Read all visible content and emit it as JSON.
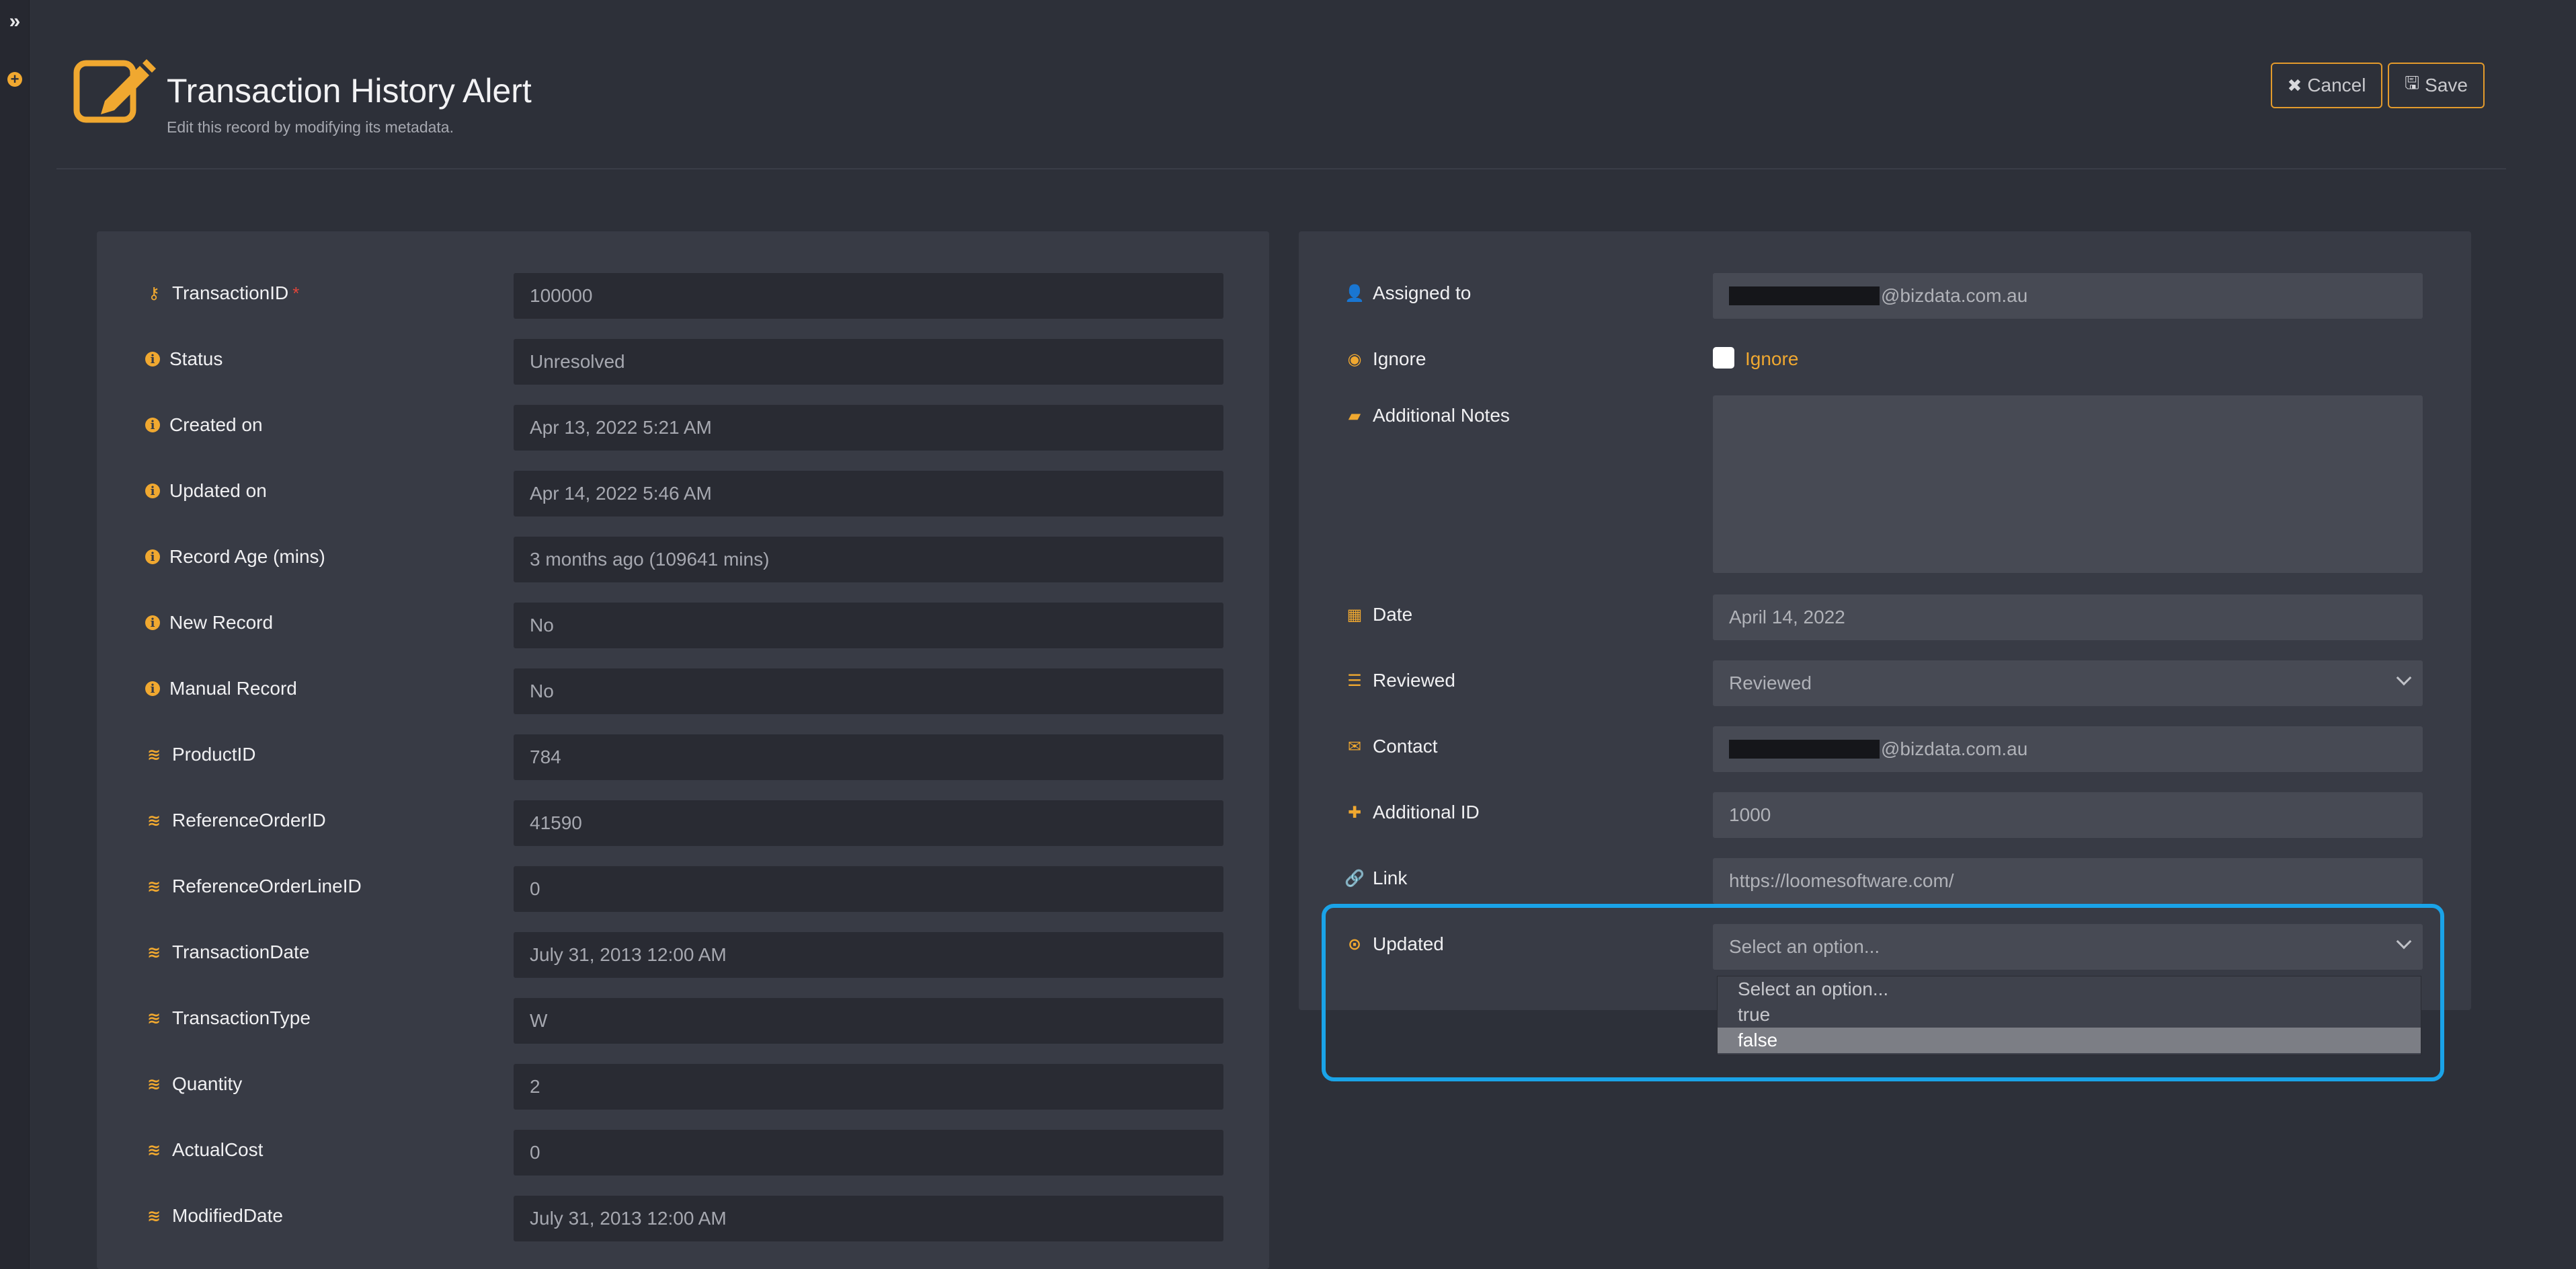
{
  "header": {
    "title": "Transaction History Alert",
    "subtitle": "Edit this record by modifying its metadata.",
    "cancel_label": "Cancel",
    "save_label": "Save"
  },
  "left_fields": [
    {
      "label": "TransactionID",
      "value": "100000",
      "icon": "key-icon",
      "required": "*"
    },
    {
      "label": "Status",
      "value": "Unresolved",
      "icon": "info-icon"
    },
    {
      "label": "Created on",
      "value": "Apr 13, 2022 5:21 AM",
      "icon": "info-icon"
    },
    {
      "label": "Updated on",
      "value": "Apr 14, 2022 5:46 AM",
      "icon": "info-icon"
    },
    {
      "label": "Record Age (mins)",
      "value": "3 months ago (109641 mins)",
      "icon": "info-icon"
    },
    {
      "label": "New Record",
      "value": "No",
      "icon": "info-icon"
    },
    {
      "label": "Manual Record",
      "value": "No",
      "icon": "info-icon"
    },
    {
      "label": "ProductID",
      "value": "784",
      "icon": "database-icon"
    },
    {
      "label": "ReferenceOrderID",
      "value": "41590",
      "icon": "database-icon"
    },
    {
      "label": "ReferenceOrderLineID",
      "value": "0",
      "icon": "database-icon"
    },
    {
      "label": "TransactionDate",
      "value": "July 31, 2013 12:00 AM",
      "icon": "database-icon"
    },
    {
      "label": "TransactionType",
      "value": "W",
      "icon": "database-icon"
    },
    {
      "label": "Quantity",
      "value": "2",
      "icon": "database-icon"
    },
    {
      "label": "ActualCost",
      "value": "0",
      "icon": "database-icon"
    },
    {
      "label": "ModifiedDate",
      "value": "July 31, 2013 12:00 AM",
      "icon": "database-icon"
    }
  ],
  "right_fields": {
    "assigned_to": {
      "label": "Assigned to",
      "value": "@bizdata.com.au"
    },
    "ignore": {
      "label": "Ignore",
      "checkbox_label": "Ignore"
    },
    "notes": {
      "label": "Additional Notes",
      "value": ""
    },
    "date": {
      "label": "Date",
      "value": "April 14, 2022"
    },
    "reviewed": {
      "label": "Reviewed",
      "value": "Reviewed"
    },
    "contact": {
      "label": "Contact",
      "value": "@bizdata.com.au"
    },
    "additional_id": {
      "label": "Additional ID",
      "value": "1000"
    },
    "link": {
      "label": "Link",
      "value": "https://loomesoftware.com/"
    },
    "updated": {
      "label": "Updated",
      "placeholder": "Select an option..."
    }
  },
  "updated_dropdown": {
    "options": [
      "Select an option...",
      "true",
      "false"
    ],
    "highlighted": "false"
  },
  "colors": {
    "accent": "#f0a830",
    "highlight": "#1aa3e8",
    "background": "#2d3039",
    "panel": "#383b45"
  }
}
